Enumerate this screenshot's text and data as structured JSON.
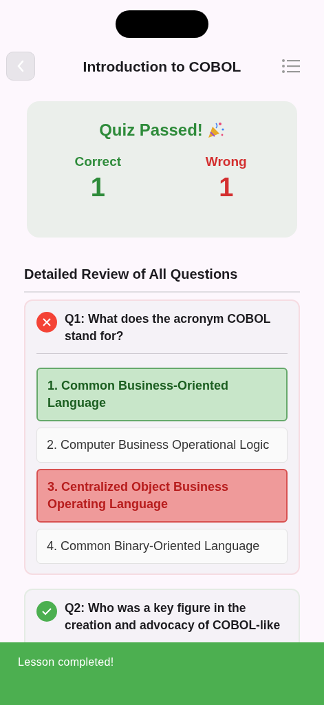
{
  "header": {
    "title": "Introduction to COBOL"
  },
  "summary": {
    "title": "Quiz Passed!",
    "correct_label": "Correct",
    "correct_count": "1",
    "wrong_label": "Wrong",
    "wrong_count": "1"
  },
  "review_heading": "Detailed Review of All Questions",
  "questions": [
    {
      "text": "Q1: What does the acronym COBOL stand for?",
      "correct": false,
      "options": [
        {
          "label": "1. Common Business-Oriented Language",
          "kind": "correct"
        },
        {
          "label": "2. Computer Business Operational Logic",
          "kind": "plain"
        },
        {
          "label": "3. Centralized Object Business Operating Language",
          "kind": "wrong"
        },
        {
          "label": "4. Common Binary-Oriented Language",
          "kind": "plain"
        }
      ]
    },
    {
      "text": "Q2: Who was a key figure in the creation and advocacy of COBOL-like",
      "correct": true
    }
  ],
  "toast": {
    "message": "Lesson completed!"
  }
}
